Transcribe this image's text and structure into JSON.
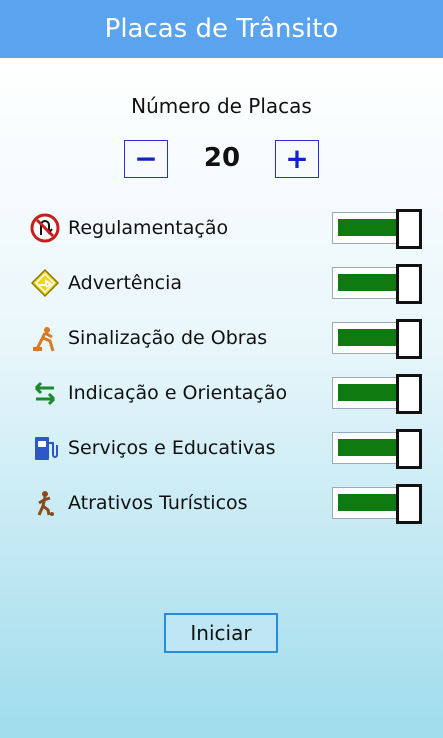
{
  "header": {
    "title": "Placas de Trânsito"
  },
  "count": {
    "title": "Número de Placas",
    "value": "20",
    "minus_label": "−",
    "plus_label": "+"
  },
  "categories": [
    {
      "label": "Regulamentação",
      "icon": "no-u-turn-sign-icon",
      "enabled": true
    },
    {
      "label": "Advertência",
      "icon": "warning-diamond-sign-icon",
      "enabled": true
    },
    {
      "label": "Sinalização de Obras",
      "icon": "road-works-icon",
      "enabled": true
    },
    {
      "label": "Indicação e Orientação",
      "icon": "two-way-arrows-icon",
      "enabled": true
    },
    {
      "label": "Serviços e Educativas",
      "icon": "fuel-pump-icon",
      "enabled": true
    },
    {
      "label": "Atrativos Turísticos",
      "icon": "football-player-icon",
      "enabled": true
    }
  ],
  "start_button": {
    "label": "Iniciar"
  },
  "colors": {
    "header": "#5aa3ee",
    "toggle_on": "#0f7a0f",
    "stepper": "#1521c8"
  }
}
